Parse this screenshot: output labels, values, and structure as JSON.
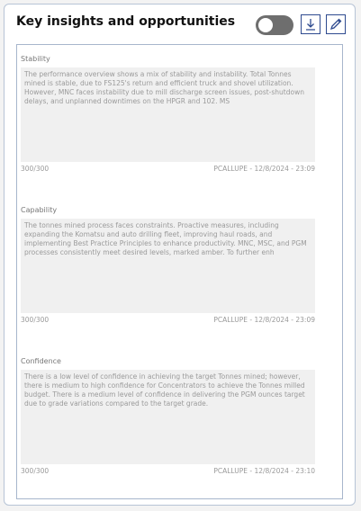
{
  "card": {
    "title": "Key insights and opportunities",
    "toggle_state": "off"
  },
  "sections": [
    {
      "label": "Stability",
      "text": "The performance overview shows a mix of stability and instability. Total Tonnes mined is stable, due to FS125's return and efficient truck and shovel utilization. However, MNC faces instability due to mill discharge screen issues, post-shutdown delays, and unplanned downtimes on the HPGR and 102. MS",
      "char_count": "300/300",
      "author_time": "PCALLUPE - 12/8/2024 - 23:09"
    },
    {
      "label": "Capability",
      "text": "The tonnes mined process faces constraints. Proactive measures, including expanding the Komatsu and auto drilling fleet, improving haul roads, and implementing Best Practice Principles to enhance productivity. MNC, MSC, and PGM processes consistently meet desired levels, marked amber. To further enh",
      "char_count": "300/300",
      "author_time": "PCALLUPE - 12/8/2024 - 23:09"
    },
    {
      "label": "Confidence",
      "text": "There is a low level of confidence in achieving the target Tonnes mined; however, there is medium to high confidence for Concentrators to achieve the Tonnes milled budget. There is a medium level of confidence in delivering the PGM ounces target due to grade variations compared to the target grade.",
      "char_count": "300/300",
      "author_time": "PCALLUPE - 12/8/2024 - 23:10"
    }
  ]
}
